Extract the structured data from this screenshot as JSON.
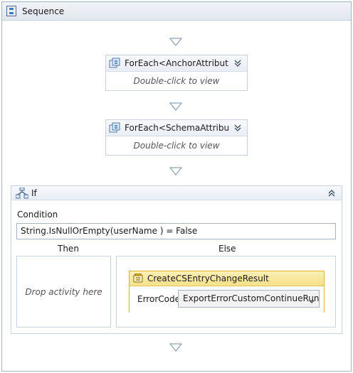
{
  "sequence": {
    "title": "Sequence",
    "icon": "sequence-icon"
  },
  "activities": [
    {
      "title": "ForEach<AnchorAttribute>",
      "hint": "Double-click to view",
      "icon": "foreach-icon",
      "toggle_icon": "collapse-chevron-icon"
    },
    {
      "title": "ForEach<SchemaAttribute>",
      "hint": "Double-click to view",
      "icon": "foreach-icon",
      "toggle_icon": "collapse-chevron-icon"
    }
  ],
  "if_activity": {
    "title": "If",
    "icon": "if-icon",
    "condition_label": "Condition",
    "condition_value": "String.IsNullOrEmpty(userName ) = False",
    "then_label": "Then",
    "else_label": "Else",
    "then_placeholder": "Drop activity here",
    "else_activity": {
      "title": "CreateCSEntryChangeResult",
      "icon": "create-result-icon",
      "field_label": "ErrorCode",
      "field_value": "ExportErrorCustomContinueRun"
    }
  },
  "colors": {
    "border": "#c9d2de",
    "header": "#e9eef5",
    "selected_border": "#e3b62d",
    "selected_header": "#f6e08a",
    "arrow": "#8ea0b8"
  }
}
